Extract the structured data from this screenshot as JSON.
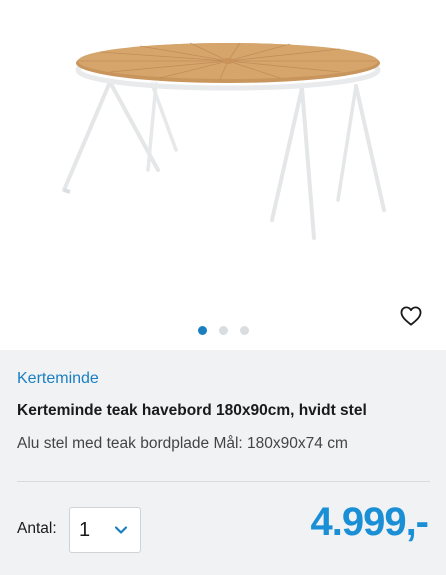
{
  "product": {
    "brand": "Kerteminde",
    "title": "Kerteminde teak havebord 180x90cm, hvidt stel",
    "description": "Alu stel med teak bordplade Mål: 180x90x74 cm"
  },
  "gallery": {
    "image_alt": "Kerteminde teak havebord",
    "dot_count": 3,
    "active_dot": 0
  },
  "purchase": {
    "quantity_label": "Antal:",
    "quantity_value": "1",
    "price": "4.999,-"
  },
  "colors": {
    "brand_blue": "#1a7fc1",
    "price_blue": "#1a8fd6",
    "info_background": "#f0f2f4"
  },
  "icons": {
    "favorite": "heart-outline-icon",
    "dropdown": "chevron-down-icon"
  }
}
